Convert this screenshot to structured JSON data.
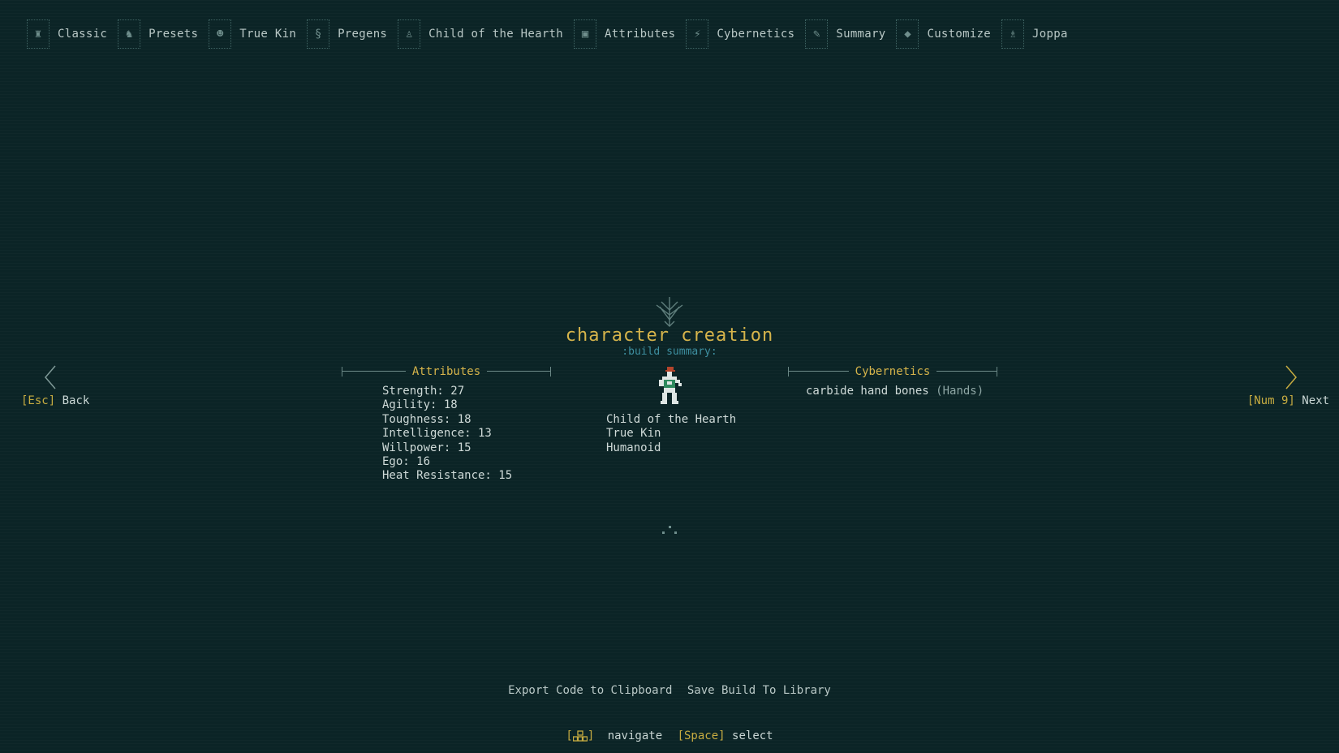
{
  "breadcrumbs": [
    {
      "label": "Classic",
      "icon": "classic-icon"
    },
    {
      "label": "Presets",
      "icon": "presets-icon"
    },
    {
      "label": "True Kin",
      "icon": "true-kin-icon"
    },
    {
      "label": "Pregens",
      "icon": "pregens-icon"
    },
    {
      "label": "Child of the Hearth",
      "icon": "hearth-icon"
    },
    {
      "label": "Attributes",
      "icon": "attributes-icon"
    },
    {
      "label": "Cybernetics",
      "icon": "cybernetics-icon"
    },
    {
      "label": "Summary",
      "icon": "summary-icon"
    },
    {
      "label": "Customize",
      "icon": "customize-icon"
    },
    {
      "label": "Joppa",
      "icon": "joppa-icon"
    }
  ],
  "header": {
    "title": "character creation",
    "subtitle": ":build summary:"
  },
  "nav": {
    "back_key": "[Esc]",
    "back_label": "Back",
    "next_key": "[Num 9]",
    "next_label": "Next"
  },
  "attributes": {
    "heading": "Attributes",
    "lines": [
      "Strength: 27",
      "Agility: 18",
      "Toughness: 18",
      "Intelligence: 13",
      "Willpower: 15",
      "Ego: 16",
      "Heat Resistance: 15"
    ]
  },
  "character": {
    "calling": "Child of the Hearth",
    "genotype": "True Kin",
    "anatomy": "Humanoid"
  },
  "cybernetics": {
    "heading": "Cybernetics",
    "item_name": "carbide hand bones",
    "item_slot": "(Hands)"
  },
  "actions": {
    "export": "Export Code to Clipboard",
    "save": "Save Build To Library"
  },
  "hints": {
    "navigate": "navigate",
    "select_key": "[Space]",
    "select": "select",
    "pad_open": "[",
    "pad_close": "]"
  },
  "colors": {
    "background": "#0b2426",
    "gold": "#d6b44b",
    "cyan": "#3e8fa0",
    "text": "#cfdad8"
  }
}
